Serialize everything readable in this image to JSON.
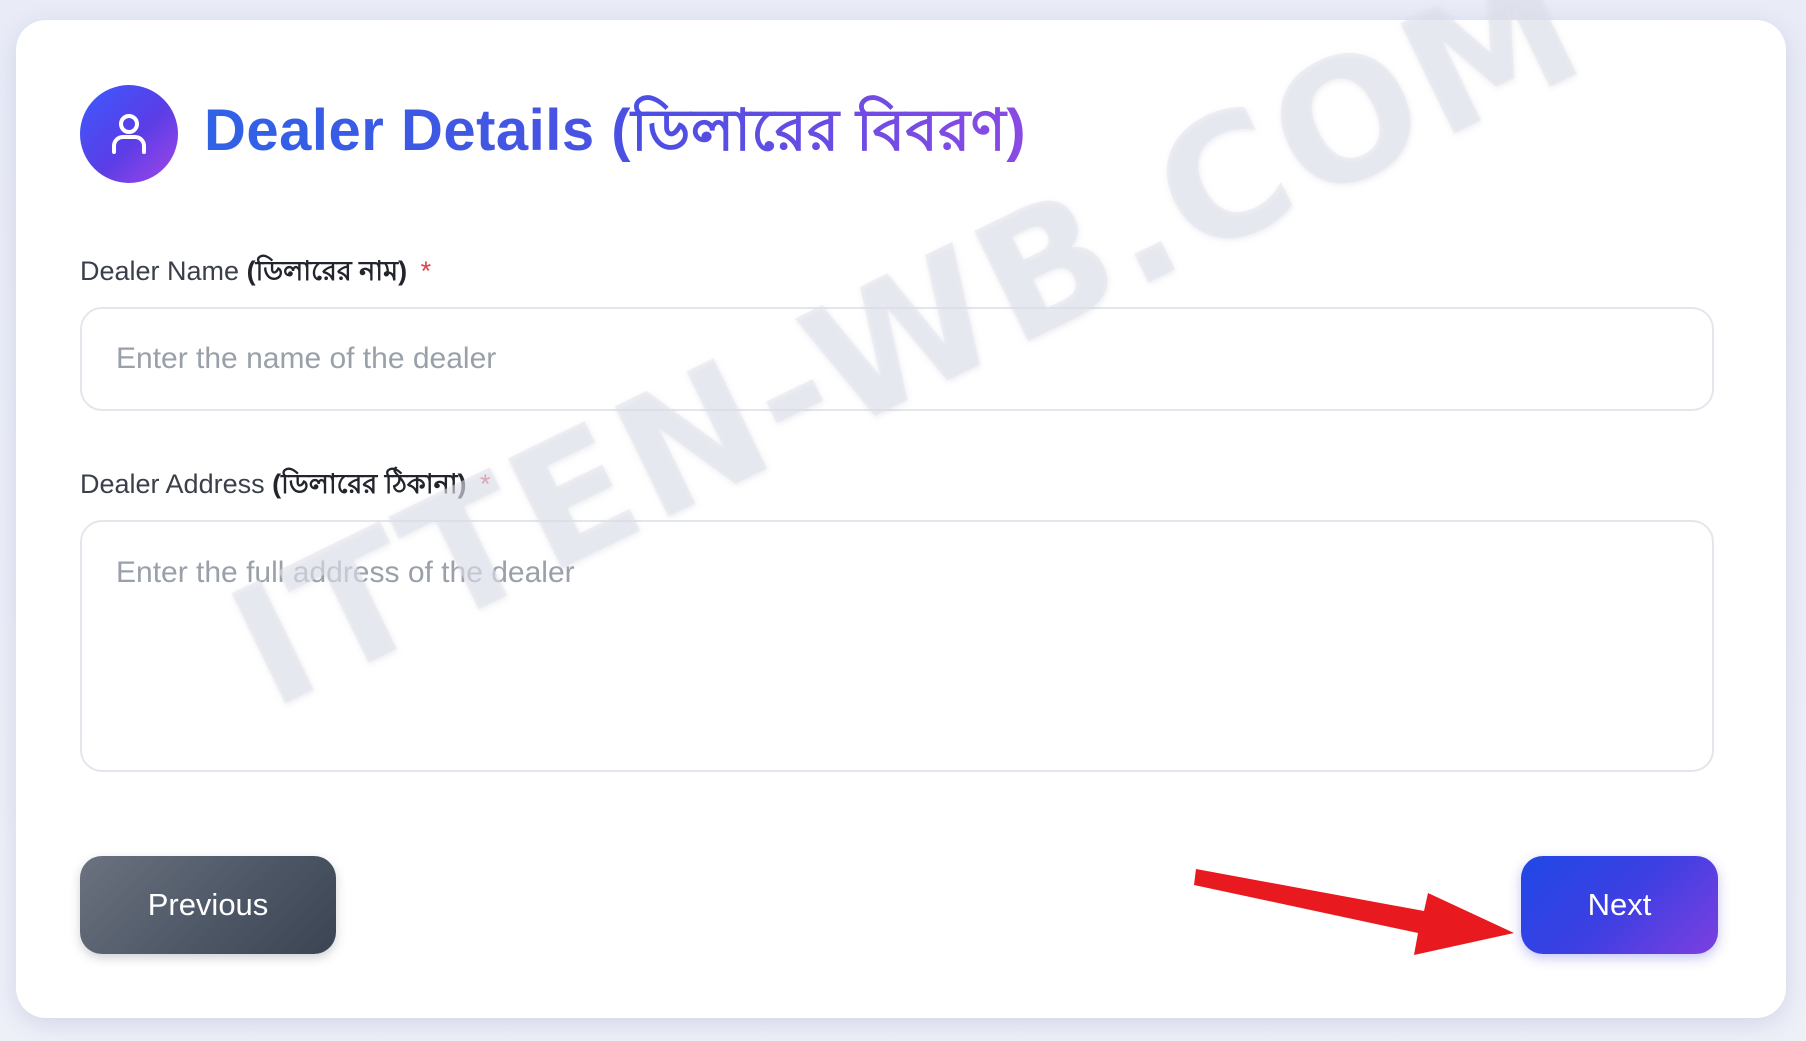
{
  "header": {
    "icon": "user-icon",
    "title": "Dealer Details (ডিলারের বিবরণ)"
  },
  "fields": {
    "dealer_name": {
      "label_en": "Dealer Name",
      "label_bn": "(ডিলারের নাম)",
      "required_mark": "*",
      "placeholder": "Enter the name of the dealer",
      "value": ""
    },
    "dealer_address": {
      "label_en": "Dealer Address",
      "label_bn": "(ডিলারের ঠিকানা)",
      "required_mark": "*",
      "placeholder": "Enter the full address of the dealer",
      "value": ""
    }
  },
  "buttons": {
    "previous_label": "Previous",
    "next_label": "Next"
  },
  "annotation": {
    "arrow_color": "#e8191f",
    "points_to": "next-button"
  },
  "watermark": {
    "text": "ITTEN-WB.COM"
  },
  "colors": {
    "accent_blue": "#2f62e6",
    "accent_purple": "#8b4ae4",
    "required_red": "#e0424a",
    "previous_gray": "#4b5563"
  }
}
